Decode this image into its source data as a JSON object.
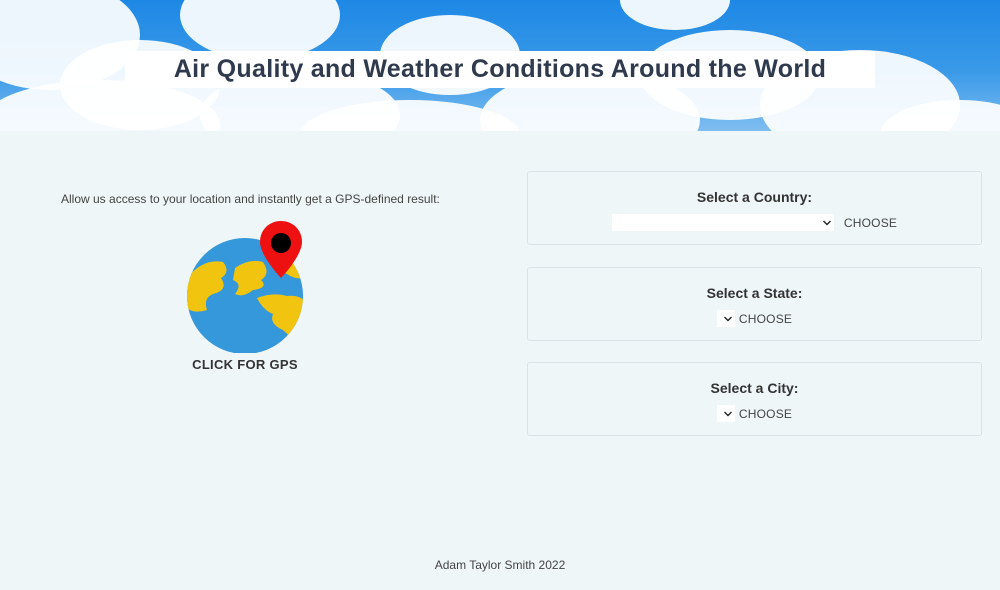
{
  "header": {
    "title": "Air Quality and Weather Conditions Around the World"
  },
  "gps": {
    "intro": "Allow us access to your location and instantly get a GPS-defined result:",
    "button_label": "CLICK FOR GPS",
    "icon": "globe-with-map-pin-icon"
  },
  "selectors": {
    "country": {
      "label": "Select a Country:",
      "value": "",
      "button": "CHOOSE"
    },
    "state": {
      "label": "Select a State:",
      "value": "",
      "button": "CHOOSE"
    },
    "city": {
      "label": "Select a City:",
      "value": "",
      "button": "CHOOSE"
    }
  },
  "footer": {
    "text": "Adam Taylor Smith 2022"
  },
  "colors": {
    "page_bg": "#eff6f8",
    "title_text": "#2f3a4d",
    "pin_red": "#ee1111",
    "globe_blue": "#3498db",
    "globe_land": "#f1c40f"
  }
}
